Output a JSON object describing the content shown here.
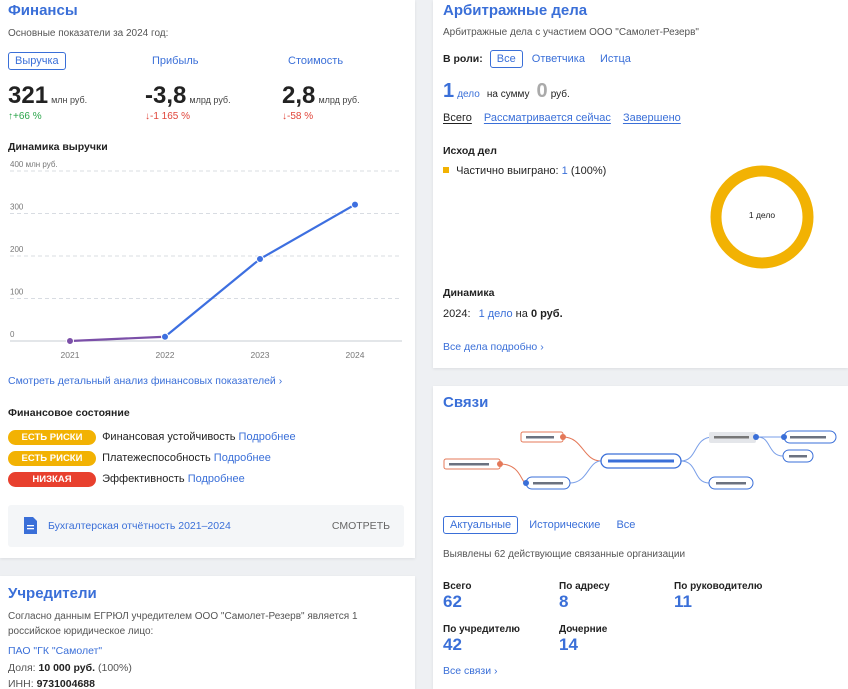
{
  "finance": {
    "title": "Финансы",
    "subtitle": "Основные показатели за 2024 год:",
    "metrics": [
      {
        "label": "Выручка",
        "value": "321",
        "unit": "млн руб.",
        "change": "↑+66 %",
        "color": "#2aa44a"
      },
      {
        "label": "Прибыль",
        "value": "-3,8",
        "unit": "млрд руб.",
        "change": "↓-1 165 %",
        "color": "#e0453a"
      },
      {
        "label": "Стоимость",
        "value": "2,8",
        "unit": "млрд руб.",
        "change": "↓-58 %",
        "color": "#e0453a"
      }
    ],
    "chart_title": "Динамика выручки",
    "detail_link": "Смотреть детальный анализ финансовых показателей",
    "state_title": "Финансовое состояние",
    "states": [
      {
        "badge": "ЕСТЬ РИСКИ",
        "color": "#f2b203",
        "label": "Финансовая устойчивость",
        "link": "Подробнее"
      },
      {
        "badge": "ЕСТЬ РИСКИ",
        "color": "#f2b203",
        "label": "Платежеспособность",
        "link": "Подробнее"
      },
      {
        "badge": "НИЗКАЯ",
        "color": "#e8402e",
        "label": "Эффективность",
        "link": "Подробнее"
      }
    ],
    "report_label": "Бухгалтерская отчётность 2021–2024",
    "report_action": "СМОТРЕТЬ"
  },
  "chart_data": {
    "type": "line",
    "x": [
      "2021",
      "2022",
      "2023",
      "2024"
    ],
    "series": [
      {
        "values": [
          0,
          10,
          193,
          321
        ]
      }
    ],
    "y_ticks": [
      "400 млн руб.",
      "300",
      "200",
      "100",
      "0"
    ],
    "ylim": [
      0,
      400
    ],
    "grid": true,
    "colors": {
      "first_segment": "#7b4fa8",
      "line": "#3d6fe0"
    }
  },
  "founders": {
    "title": "Учредители",
    "text": "Согласно данным ЕГРЮЛ учредителем ООО \"Самолет-Резерв\" является 1 российское юридическое лицо:",
    "company": "ПАО \"ГК \"Самолет\"",
    "share_label": "Доля:",
    "share_value": "10 000 руб.",
    "share_pct": "(100%)",
    "inn_label": "ИНН:",
    "inn_value": "9731004688"
  },
  "arbitration": {
    "title": "Арбитражные дела",
    "subtitle": "Арбитражные дела с участием ООО \"Самолет-Резерв\"",
    "role_label": "В роли:",
    "roles": [
      "Все",
      "Ответчика",
      "Истца"
    ],
    "count": "1",
    "count_unit": "дело",
    "sum_label": "на сумму",
    "sum_value": "0",
    "sum_unit": "руб.",
    "filters": [
      "Всего",
      "Рассматривается сейчас",
      "Завершено"
    ],
    "outcome_title": "Исход дел",
    "outcome_label": "Частично выиграно:",
    "outcome_count": "1",
    "outcome_pct": "(100%)",
    "donut_label": "1 дело",
    "donut_color": "#f2b203",
    "dynamics_title": "Динамика",
    "dyn_year": "2024:",
    "dyn_count": "1 дело",
    "dyn_sum_label": "на",
    "dyn_sum": "0 руб.",
    "all_link": "Все дела подробно"
  },
  "links": {
    "title": "Связи",
    "tabs": [
      "Актуальные",
      "Исторические",
      "Все"
    ],
    "summary": "Выявлены 62 действующие связанные организации",
    "stats": [
      {
        "label": "Всего",
        "value": "62"
      },
      {
        "label": "По адресу",
        "value": "8"
      },
      {
        "label": "По руководителю",
        "value": "11"
      },
      {
        "label": "По учредителю",
        "value": "42"
      },
      {
        "label": "Дочерние",
        "value": "14"
      }
    ],
    "all_link": "Все связи"
  }
}
